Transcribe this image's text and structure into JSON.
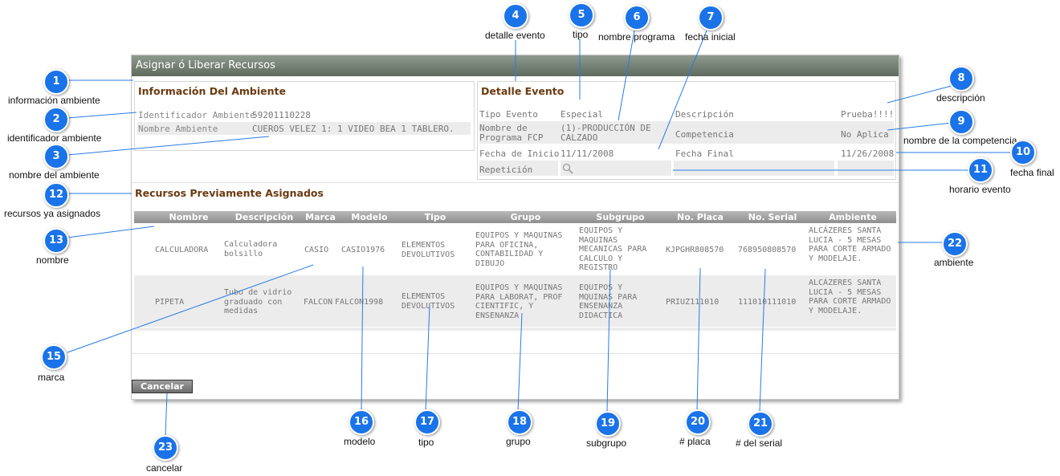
{
  "window": {
    "title": "Asignar ó Liberar Recursos"
  },
  "environment": {
    "title": "Información Del Ambiente",
    "id_label": "Identificador Ambiente",
    "id_value": "59201110228",
    "name_label": "Nombre Ambiente",
    "name_value": "CUEROS VELEZ 1: 1 VIDEO BEA 1 TABLERO."
  },
  "event": {
    "title": "Detalle Evento",
    "tipo_label": "Tipo Evento",
    "tipo_value": "Especial",
    "programa_label": "Nombre de Programa FCP",
    "programa_value": "(1)-PRODUCCIÓN DE CALZADO",
    "inicio_label": "Fecha de Inicio",
    "inicio_value": "11/11/2008",
    "repeticion_label": "Repetición",
    "descripcion_label": "Descripción",
    "descripcion_value": "Prueba!!!!",
    "competencia_label": "Competencia",
    "competencia_value": "No Aplica",
    "final_label": "Fecha Final",
    "final_value": "11/26/2008"
  },
  "resources": {
    "title": "Recursos Previamente Asignados",
    "columns": [
      "Nombre",
      "Descripción",
      "Marca",
      "Modelo",
      "Tipo",
      "Grupo",
      "Subgrupo",
      "No. Placa",
      "No. Serial",
      "Ambiente"
    ],
    "rows": [
      [
        "CALCULADORA",
        "Calculadora bolsillo",
        "CASIO",
        "CASIO1976",
        "ELEMENTOS DEVOLUTIVOS",
        "EQUIPOS Y MAQUINAS PARA OFICINA, CONTABILIDAD Y DIBUJO",
        "EQUIPOS Y MAQUINAS MECANICAS PARA CALCULO Y REGISTRO",
        "KJPGHR808570",
        "768950808570",
        "ALCÁZERES SANTA LUCIA - 5 MESAS PARA CORTE ARMADO Y MODELAJE."
      ],
      [
        "PIPETA",
        "Tubo de vidrio graduado con medidas",
        "FALCON",
        "FALCON1998",
        "ELEMENTOS DEVOLUTIVOS",
        "EQUIPOS Y MAQUINAS PARA LABORAT, PROF CIENTIFIC, Y ENSENANZA",
        "EQUIPOS Y MQUINAS PARA ENSENANZA DIDACTICA",
        "PRIUZ111010",
        "111010111010",
        "ALCÁZERES SANTA LUCIA - 5 MESAS PARA CORTE ARMADO Y MODELAJE."
      ]
    ]
  },
  "cancel_label": "Cancelar",
  "callouts": [
    {
      "n": "1",
      "label": "información ambiente"
    },
    {
      "n": "2",
      "label": "identificador ambiente"
    },
    {
      "n": "3",
      "label": "nombre del ambiente"
    },
    {
      "n": "4",
      "label": "detalle evento"
    },
    {
      "n": "5",
      "label": "tipo"
    },
    {
      "n": "6",
      "label": "nombre programa"
    },
    {
      "n": "7",
      "label": "fecha inicial"
    },
    {
      "n": "8",
      "label": "descripción"
    },
    {
      "n": "9",
      "label": "nombre de la competencia"
    },
    {
      "n": "10",
      "label": "fecha final"
    },
    {
      "n": "11",
      "label": "horario evento"
    },
    {
      "n": "12",
      "label": "recursos ya asignados"
    },
    {
      "n": "13",
      "label": "nombre"
    },
    {
      "n": "15",
      "label": "marca"
    },
    {
      "n": "16",
      "label": "modelo"
    },
    {
      "n": "17",
      "label": "tipo"
    },
    {
      "n": "18",
      "label": "grupo"
    },
    {
      "n": "19",
      "label": "subgrupo"
    },
    {
      "n": "20",
      "label": "# placa"
    },
    {
      "n": "21",
      "label": "# del serial"
    },
    {
      "n": "22",
      "label": "ambiente"
    },
    {
      "n": "23",
      "label": "cancelar"
    }
  ],
  "colors": {
    "accent": "#1a73e8",
    "title_brown": "#6b3a10",
    "titlebar": "#6f7c6f"
  }
}
